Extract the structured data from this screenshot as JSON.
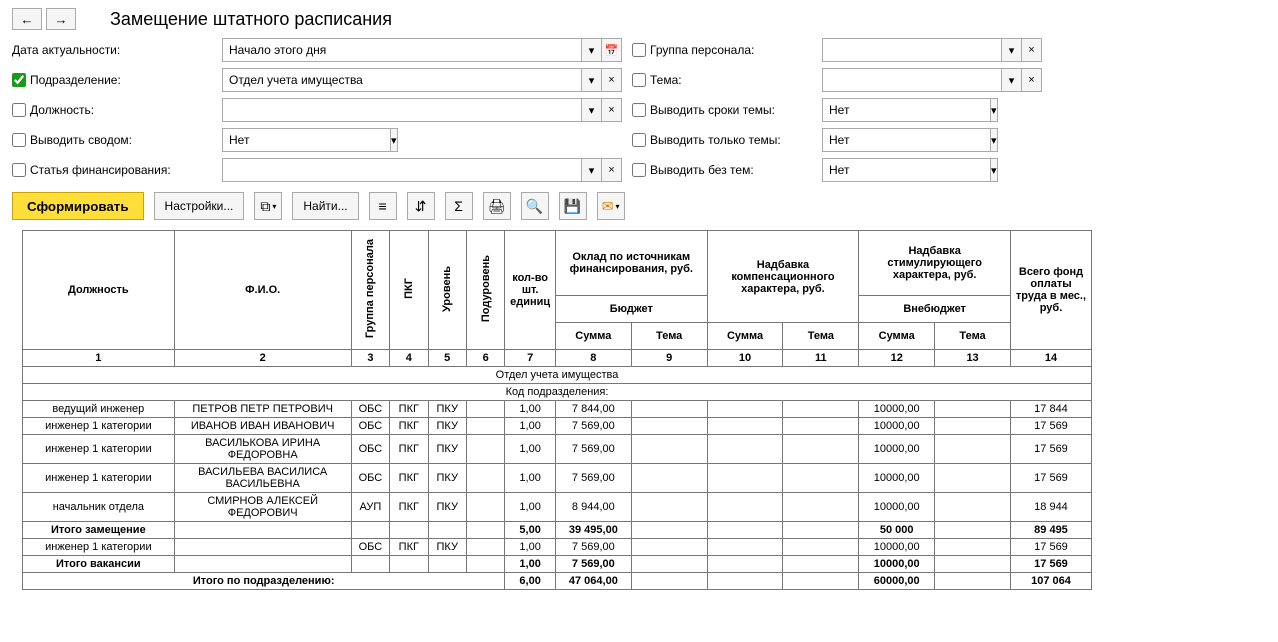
{
  "nav": {
    "back": "←",
    "forward": "→"
  },
  "title": "Замещение штатного расписания",
  "filters": {
    "date_label": "Дата актуальности:",
    "date_value": "Начало этого дня",
    "group_label": "Группа персонала:",
    "group_value": "",
    "subdiv_label": "Подразделение:",
    "subdiv_value": "Отдел учета имущества",
    "topic_label": "Тема:",
    "topic_value": "",
    "position_label": "Должность:",
    "position_value": "",
    "show_topic_terms_label": "Выводить сроки темы:",
    "show_topic_terms_value": "Нет",
    "summary_label": "Выводить сводом:",
    "summary_value": "Нет",
    "only_topics_label": "Выводить только темы:",
    "only_topics_value": "Нет",
    "finance_label": "Статья финансирования:",
    "finance_value": "",
    "no_topics_label": "Выводить без тем:",
    "no_topics_value": "Нет"
  },
  "toolbar": {
    "generate": "Сформировать",
    "settings": "Настройки...",
    "find": "Найти..."
  },
  "icons": {
    "caret": "▾",
    "calendar": "📅",
    "clear": "×",
    "copy": "⧉",
    "expand": "≡",
    "drill": "⇵",
    "sum": "Σ",
    "print": "🖨",
    "preview": "🔍",
    "save": "💾",
    "mail": "✉"
  },
  "chart_data": {
    "type": "table",
    "title": "Замещение штатного расписания",
    "headers": {
      "position": "Должность",
      "fio": "Ф.И.О.",
      "group": "Группа персонала",
      "pkg": "ПКГ",
      "level": "Уровень",
      "sublevel": "Подуровень",
      "qty": "кол-во шт. единиц",
      "salary_group": "Оклад по источникам финансирования, руб.",
      "budget": "Бюджет",
      "comp_group": "Надбавка компенсационного характера, руб.",
      "stim_group": "Надбавка стимулирующего характера, руб.",
      "offbudget": "Внебюджет",
      "sum": "Сумма",
      "topic": "Тема",
      "total": "Всего фонд оплаты труда в мес., руб."
    },
    "cols": [
      "1",
      "2",
      "3",
      "4",
      "5",
      "6",
      "7",
      "8",
      "9",
      "10",
      "11",
      "12",
      "13",
      "14"
    ],
    "section": "Отдел учета имущества",
    "code_label": "Код подразделения:",
    "rows": [
      {
        "position": "ведущий инженер",
        "fio": "ПЕТРОВ ПЕТР ПЕТРОВИЧ",
        "group": "ОБС",
        "pkg": "ПКГ",
        "level": "ПКУ",
        "sublevel": "",
        "qty": "1,00",
        "s8": "7 844,00",
        "s9": "",
        "s10": "",
        "s11": "",
        "s12": "10000,00",
        "s13": "",
        "s14": "17 844"
      },
      {
        "position": "инженер 1 категории",
        "fio": "ИВАНОВ ИВАН ИВАНОВИЧ",
        "group": "ОБС",
        "pkg": "ПКГ",
        "level": "ПКУ",
        "sublevel": "",
        "qty": "1,00",
        "s8": "7 569,00",
        "s9": "",
        "s10": "",
        "s11": "",
        "s12": "10000,00",
        "s13": "",
        "s14": "17 569"
      },
      {
        "position": "инженер 1 категории",
        "fio": "ВАСИЛЬКОВА ИРИНА ФЕДОРОВНА",
        "group": "ОБС",
        "pkg": "ПКГ",
        "level": "ПКУ",
        "sublevel": "",
        "qty": "1,00",
        "s8": "7 569,00",
        "s9": "",
        "s10": "",
        "s11": "",
        "s12": "10000,00",
        "s13": "",
        "s14": "17 569"
      },
      {
        "position": "инженер 1 категории",
        "fio": "ВАСИЛЬЕВА ВАСИЛИСА ВАСИЛЬЕВНА",
        "group": "ОБС",
        "pkg": "ПКГ",
        "level": "ПКУ",
        "sublevel": "",
        "qty": "1,00",
        "s8": "7 569,00",
        "s9": "",
        "s10": "",
        "s11": "",
        "s12": "10000,00",
        "s13": "",
        "s14": "17 569"
      },
      {
        "position": "начальник отдела",
        "fio": "СМИРНОВ АЛЕКСЕЙ ФЕДОРОВИЧ",
        "group": "АУП",
        "pkg": "ПКГ",
        "level": "ПКУ",
        "sublevel": "",
        "qty": "1,00",
        "s8": "8 944,00",
        "s9": "",
        "s10": "",
        "s11": "",
        "s12": "10000,00",
        "s13": "",
        "s14": "18 944"
      }
    ],
    "subtotal1": {
      "label": "Итого замещение",
      "qty": "5,00",
      "s8": "39 495,00",
      "s12": "50 000",
      "s14": "89 495"
    },
    "vacancy": {
      "position": "инженер 1 категории",
      "group": "ОБС",
      "pkg": "ПКГ",
      "level": "ПКУ",
      "qty": "1,00",
      "s8": "7 569,00",
      "s12": "10000,00",
      "s14": "17 569"
    },
    "subtotal2": {
      "label": "Итого вакансии",
      "qty": "1,00",
      "s8": "7 569,00",
      "s12": "10000,00",
      "s14": "17 569"
    },
    "grand": {
      "label": "Итого по подразделению:",
      "qty": "6,00",
      "s8": "47 064,00",
      "s12": "60000,00",
      "s14": "107 064"
    }
  }
}
